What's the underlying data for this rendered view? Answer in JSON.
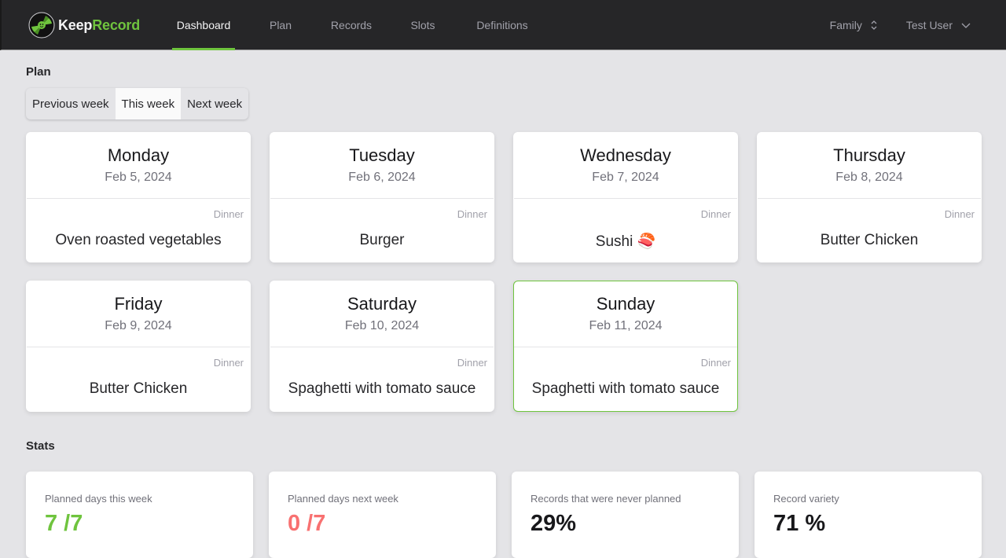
{
  "app": {
    "brand_part1": "Keep",
    "brand_part2": "Record",
    "logo_icon": "vinyl-record-icon"
  },
  "nav": {
    "items": [
      {
        "label": "Dashboard",
        "active": true
      },
      {
        "label": "Plan",
        "active": false
      },
      {
        "label": "Records",
        "active": false
      },
      {
        "label": "Slots",
        "active": false
      },
      {
        "label": "Definitions",
        "active": false
      }
    ]
  },
  "menus": {
    "group": {
      "label": "Family",
      "icon": "chevron-up-down-icon"
    },
    "user": {
      "label": "Test User",
      "icon": "chevron-down-icon"
    }
  },
  "plan": {
    "title": "Plan",
    "week_selector": {
      "options": [
        "Previous week",
        "This week",
        "Next week"
      ],
      "selected": "This week"
    },
    "days": [
      {
        "day": "Monday",
        "date": "Feb 5, 2024",
        "slot": "Dinner",
        "meal": "Oven roasted vegetables",
        "today": false
      },
      {
        "day": "Tuesday",
        "date": "Feb 6, 2024",
        "slot": "Dinner",
        "meal": "Burger",
        "today": false
      },
      {
        "day": "Wednesday",
        "date": "Feb 7, 2024",
        "slot": "Dinner",
        "meal": "Sushi 🍣",
        "today": false
      },
      {
        "day": "Thursday",
        "date": "Feb 8, 2024",
        "slot": "Dinner",
        "meal": "Butter Chicken",
        "today": false
      },
      {
        "day": "Friday",
        "date": "Feb 9, 2024",
        "slot": "Dinner",
        "meal": "Butter Chicken",
        "today": false
      },
      {
        "day": "Saturday",
        "date": "Feb 10, 2024",
        "slot": "Dinner",
        "meal": "Spaghetti with tomato sauce",
        "today": false
      },
      {
        "day": "Sunday",
        "date": "Feb 11, 2024",
        "slot": "Dinner",
        "meal": "Spaghetti with tomato sauce",
        "today": true
      }
    ]
  },
  "stats": {
    "title": "Stats",
    "cards": [
      {
        "label": "Planned days this week",
        "value": "7 /7",
        "color": "#6fc43e"
      },
      {
        "label": "Planned days next week",
        "value": "0 /7",
        "color": "#f87171"
      },
      {
        "label": "Records that were never planned",
        "value": "29%",
        "color": "#18181b"
      },
      {
        "label": "Record variety",
        "value": "71 %",
        "color": "#18181b"
      }
    ]
  },
  "colors": {
    "accent": "#6fc43e",
    "danger": "#f87171",
    "topbar": "#262628",
    "page_bg": "#e4e4e7"
  }
}
